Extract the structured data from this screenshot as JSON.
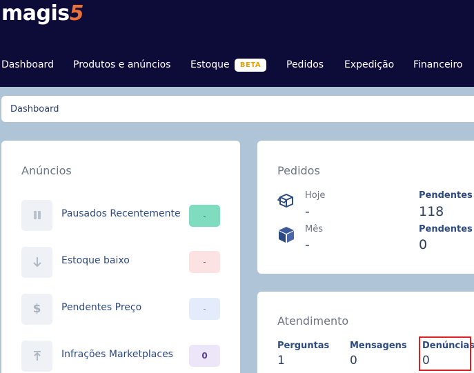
{
  "brand": {
    "logo_text": "magis",
    "logo_suffix": "5"
  },
  "nav": {
    "items": [
      "Dashboard",
      "Produtos e anúncios",
      "Estoque",
      "Pedidos",
      "Expedição",
      "Financeiro"
    ],
    "badge": "BETA"
  },
  "breadcrumb": "Dashboard",
  "anuncios": {
    "title": "Anúncios",
    "rows": [
      {
        "label": "Pausados Recentemente",
        "value": "-",
        "icon": "pause-icon",
        "badge_color": "#7fdcbf"
      },
      {
        "label": "Estoque baixo",
        "value": "-",
        "icon": "arrow-down-icon",
        "badge_color": "#fde2e4"
      },
      {
        "label": "Pendentes Preço",
        "value": "-",
        "icon": "dollar-icon",
        "badge_color": "#e4ecfb"
      },
      {
        "label": "Infrações Marketplaces",
        "value": "0",
        "icon": "arrow-up-icon",
        "badge_color": "#ede6f8"
      }
    ]
  },
  "pedidos": {
    "title": "Pedidos",
    "hoje_label": "Hoje",
    "hoje_value": "-",
    "mes_label": "Mês",
    "mes_value": "-",
    "pend1_label": "Pendentes I",
    "pend1_value": "118",
    "pend2_label": "Pendentes F",
    "pend2_value": "0"
  },
  "atendimento": {
    "title": "Atendimento",
    "perguntas_label": "Perguntas",
    "perguntas_value": "1",
    "mensagens_label": "Mensagens",
    "mensagens_value": "0",
    "denuncias_label": "Denúncias",
    "denuncias_value": "0"
  }
}
